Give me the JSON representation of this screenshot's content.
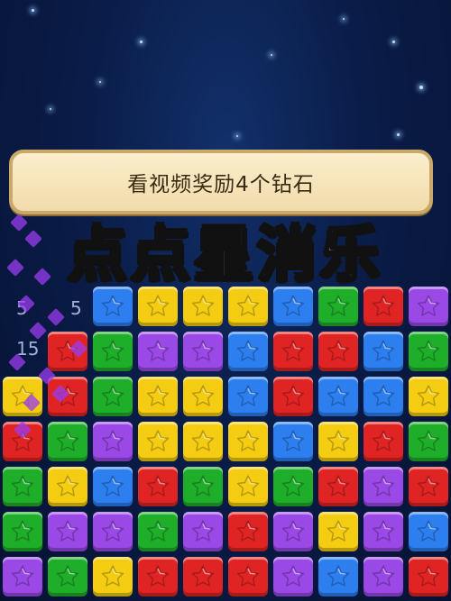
{
  "banner": {
    "text": "看视频奖励4个钻石"
  },
  "title": "点点星消乐",
  "scores": [
    "5",
    "5",
    "15"
  ],
  "colors": {
    "blue": "#2d7ff0",
    "yellow": "#f4cc12",
    "red": "#e02424",
    "green": "#1fae2a",
    "purple": "#9a48e6"
  },
  "board": {
    "icon": "star-icon",
    "rows": [
      [
        "",
        "",
        "blue",
        "yellow",
        "yellow",
        "yellow",
        "blue",
        "green",
        "red",
        "purple"
      ],
      [
        "",
        "red",
        "green",
        "purple",
        "purple",
        "blue",
        "red",
        "red",
        "blue",
        "green"
      ],
      [
        "yellow",
        "red",
        "green",
        "yellow",
        "yellow",
        "blue",
        "red",
        "blue",
        "blue",
        "yellow"
      ],
      [
        "red",
        "green",
        "purple",
        "yellow",
        "yellow",
        "yellow",
        "blue",
        "yellow",
        "red",
        "green"
      ],
      [
        "green",
        "yellow",
        "blue",
        "red",
        "green",
        "yellow",
        "green",
        "red",
        "purple",
        "red"
      ],
      [
        "green",
        "purple",
        "purple",
        "green",
        "purple",
        "red",
        "purple",
        "yellow",
        "purple",
        "blue"
      ],
      [
        "purple",
        "green",
        "yellow",
        "red",
        "red",
        "red",
        "purple",
        "blue",
        "purple",
        "red"
      ]
    ]
  }
}
